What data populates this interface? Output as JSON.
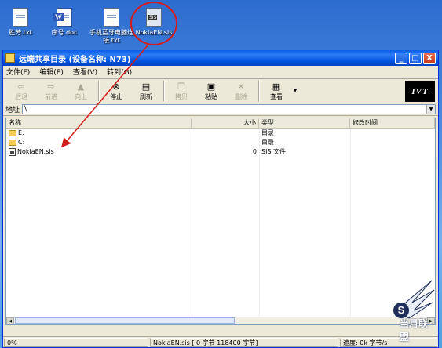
{
  "desktop": {
    "icons": [
      {
        "label": "胜芳.txt",
        "icon": "text-file-icon"
      },
      {
        "label": "序号.doc",
        "icon": "word-doc-icon"
      },
      {
        "label": "手机蓝牙电脑连接.txt",
        "icon": "text-file-icon"
      },
      {
        "label": "NokiaEN.sis",
        "icon": "sis-file-icon"
      }
    ],
    "annotation_color": "#d41c1c"
  },
  "window": {
    "title": "远端共享目录 (设备名称: N73)",
    "controls": {
      "minimize": "_",
      "maximize": "□",
      "close": "X"
    }
  },
  "menu": {
    "file": "文件(F)",
    "edit": "编辑(E)",
    "view": "查看(V)",
    "goto": "转到(G)"
  },
  "toolbar": {
    "back": "后退",
    "forward": "前进",
    "up": "向上",
    "stop": "停止",
    "refresh": "刷新",
    "copy": "拷贝",
    "paste": "粘贴",
    "delete": "删除",
    "view": "查看",
    "logo": "IVT"
  },
  "address": {
    "label": "地址",
    "value": "\\"
  },
  "columns": {
    "name": "名称",
    "size": "大小",
    "type": "类型",
    "modified": "修改时间"
  },
  "rows": [
    {
      "name": "E:",
      "size": "",
      "type": "目录",
      "modified": "",
      "icon": "folder-icon"
    },
    {
      "name": "C:",
      "size": "",
      "type": "目录",
      "modified": "",
      "icon": "folder-icon"
    },
    {
      "name": "NokiaEN.sis",
      "size": "0",
      "type": "SIS 文件",
      "modified": "",
      "icon": "sis-file-icon"
    }
  ],
  "status": {
    "progress": "0%",
    "transfer": "NokiaEN.sis [ 0 字节 118400 字节]",
    "speed": "速度: 0k 字节/s"
  },
  "watermark": {
    "text": "当月联盟"
  }
}
